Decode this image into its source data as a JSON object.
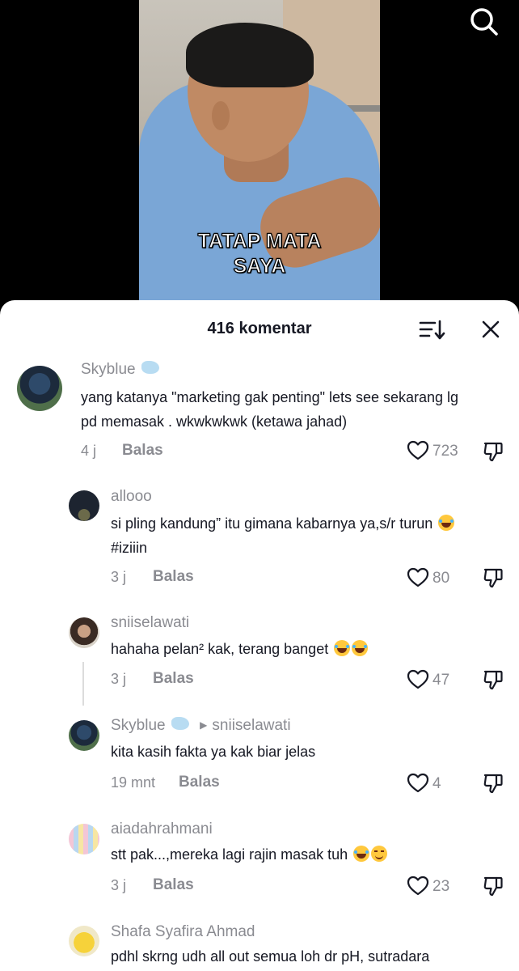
{
  "video": {
    "caption_line1": "TATAP MATA",
    "caption_line2": "SAYA"
  },
  "icons": {
    "search": "search-icon",
    "sort": "sort-icon",
    "close": "close-icon",
    "like": "heart-icon",
    "dislike": "thumbs-down-icon"
  },
  "sheet": {
    "title": "416 komentar"
  },
  "comments": [
    {
      "username": "Skyblue",
      "emoji": "dolphin",
      "text_line1": "yang katanya \"marketing gak penting\" lets see sekarang lg",
      "text_line2": "pd memasak . wkwkwkwk (ketawa jahad)",
      "time": "4 j",
      "reply_label": "Balas",
      "likes": "723"
    },
    {
      "username": "allooo",
      "text_line1": "si pling kandung” itu gimana kabarnya ya,s/r turun",
      "text_line2": "#iziiin",
      "time": "3 j",
      "reply_label": "Balas",
      "likes": "80"
    },
    {
      "username": "sniiselawati",
      "text_line1": "hahaha pelan² kak, terang banget",
      "time": "3 j",
      "reply_label": "Balas",
      "likes": "47"
    },
    {
      "username": "Skyblue",
      "reply_to": "sniiselawati",
      "text_line1": "kita kasih fakta ya kak biar jelas",
      "time": "19 mnt",
      "reply_label": "Balas",
      "likes": "4"
    },
    {
      "username": "aiadahrahmani",
      "text_line1": "stt pak...,mereka lagi rajin masak tuh",
      "time": "3 j",
      "reply_label": "Balas",
      "likes": "23"
    },
    {
      "username": "Shafa Syafira Ahmad",
      "text_line1": "pdhl skrng udh all out semua loh dr pH, sutradara"
    }
  ]
}
